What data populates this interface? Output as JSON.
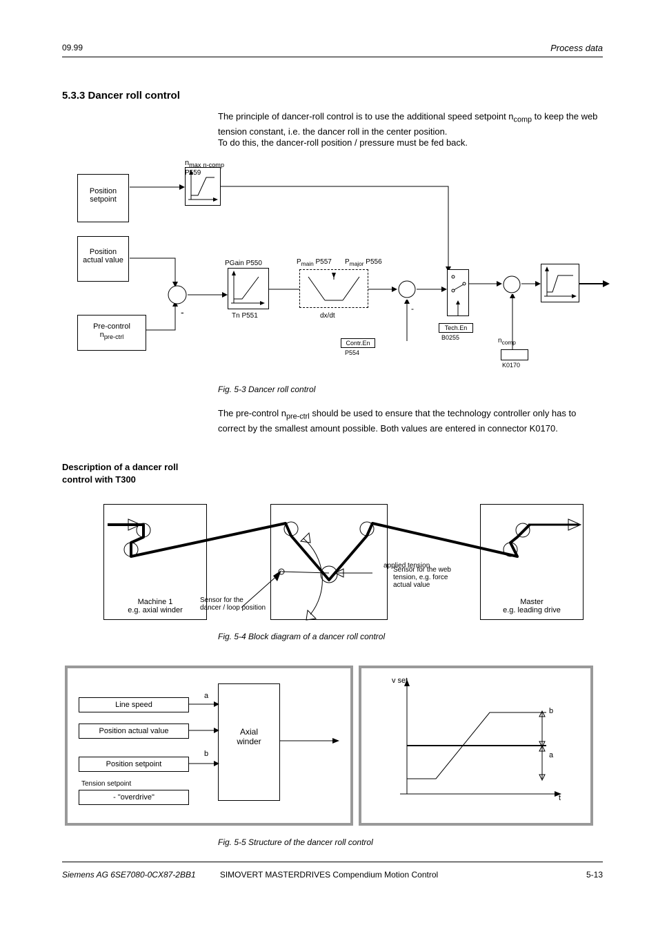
{
  "header": {
    "left": "09.99",
    "right": "Process data"
  },
  "section1": {
    "title": "5.3.3 Dancer roll control",
    "para1": "The principle of dancer-roll control is to use the additional speed setpoint n",
    "para1_sub": "comp",
    "para1_cont": " to keep the web tension constant, i.e. the dancer roll in the center position.",
    "para2": "To do this, the dancer-roll position / pressure must be fed back.",
    "para3": "The pre-control n",
    "para3_sub": "pre-ctrl",
    "para3_cont": " should be used to ensure that the technology controller only has to correct by the smallest amount possible. Both values are entered in connector K0170."
  },
  "diagram1": {
    "box_pos_setpoint_l1": "Position",
    "box_pos_setpoint_l2": "setpoint",
    "box_pos_actual_l1": "Position",
    "box_pos_actual_l2": "actual value",
    "box_pre_ctrl_l1": "Pre-control",
    "box_pre_ctrl_l2": "n",
    "box_pre_ctrl_sub": "pre-ctrl",
    "minus_sign": "-",
    "n_max_label": "n",
    "n_max_sub1": "max",
    "n_max_sub2": "n-comp",
    "n_max_sub3": "P559",
    "p_gain": "PGain P550",
    "tn": "Tn P551",
    "dx_dt": "dx/dt",
    "p_main_l1": "P",
    "p_main_l2": "main",
    "p_main_l3": "P557",
    "p_major_l1": "P",
    "p_major_l2": "major",
    "p_major_l3": "P556",
    "minus2": "-",
    "contr_en_l1": "Contr.En",
    "contr_en_l2": "P554",
    "tech_en_l1": "Tech.En",
    "tech_en_l2": "B0255",
    "n_comp": "n",
    "n_comp_sub": "comp",
    "k0170": "K0170",
    "caption": "Fig. 5-3      Dancer roll control"
  },
  "section2": {
    "title": "Description of a dancer roll control with T300"
  },
  "diagram2": {
    "machine1_l1": "Machine 1",
    "machine1_l2": "e.g. axial winder",
    "master_l1": "Master",
    "master_l2": "e.g. leading drive",
    "sensor_pos_l1": "Sensor for the",
    "sensor_pos_l2": "dancer / loop position",
    "sensor_ten_l1": "Sensor for the web",
    "sensor_ten_l2": "tension, e.g. force",
    "sensor_ten_l3": "actual value",
    "applied_tension": "applied tension",
    "caption": "Fig. 5-4      Block diagram of a dancer roll control"
  },
  "panels": {
    "box_line_speed": "Line speed",
    "box_pos_act": "Position actual value",
    "box_pos_setp": "Position setpoint",
    "box_tension_setp": "      - \"overdrive\"     ",
    "box_tension_setp_note": "Tension setpoint",
    "winder_l1": "Axial",
    "winder_l2": "winder",
    "arrow_a": "a",
    "arrow_b": "b",
    "chart": {
      "y_label": "v set",
      "x_label": "t",
      "note_a": "a",
      "note_b": "b"
    },
    "caption": "Fig. 5-5      Structure of the dancer roll control"
  },
  "footer": {
    "left": "Siemens AG         6SE7080-0CX87-2BB1",
    "center": "SIMOVERT MASTERDRIVES         Compendium Motion Control",
    "right": "5-13"
  }
}
